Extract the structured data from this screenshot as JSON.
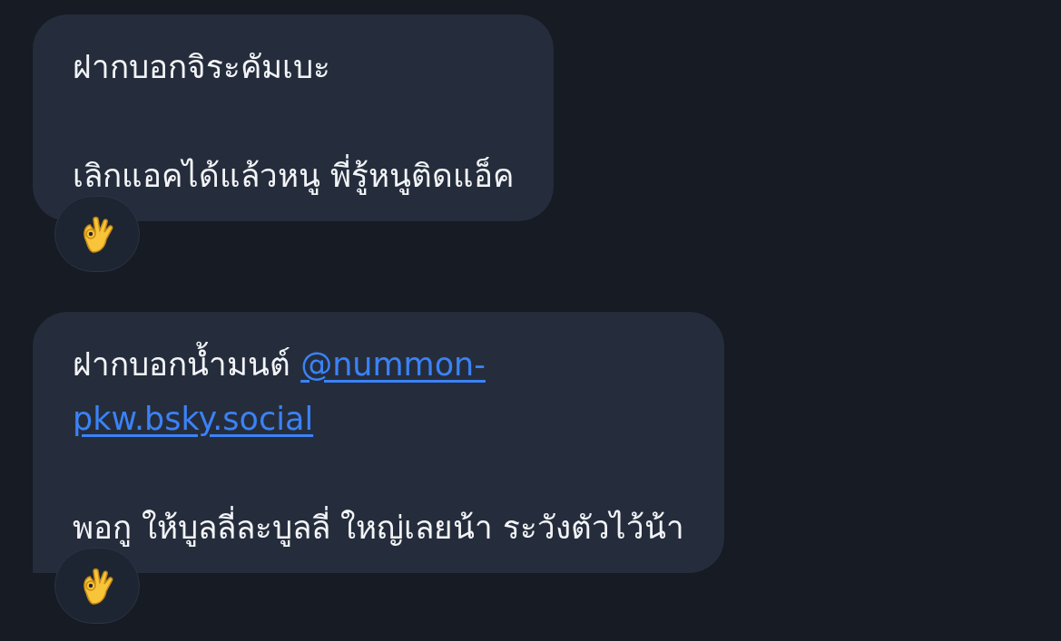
{
  "messages": [
    {
      "paragraphs": [
        {
          "text": "ฝากบอกจิระคัมเบะ"
        },
        {
          "text": "เลิกแอคได้แล้วหนู พี่รู้หนูติดแอ็ค"
        }
      ],
      "square_corner": false,
      "reactions": [
        {
          "kind": "ok-hand"
        }
      ]
    },
    {
      "paragraphs": [
        {
          "text": "ฝากบอกน้ำมนต์ ",
          "link": "@nummon-pkw.bsky.social"
        },
        {
          "text": "พอกู ให้บูลลี่ละบูลลี่ ใหญ่เลยน้า ระวังตัวไว้น้า"
        }
      ],
      "square_corner": true,
      "reactions": [
        {
          "kind": "ok-hand"
        }
      ]
    }
  ]
}
